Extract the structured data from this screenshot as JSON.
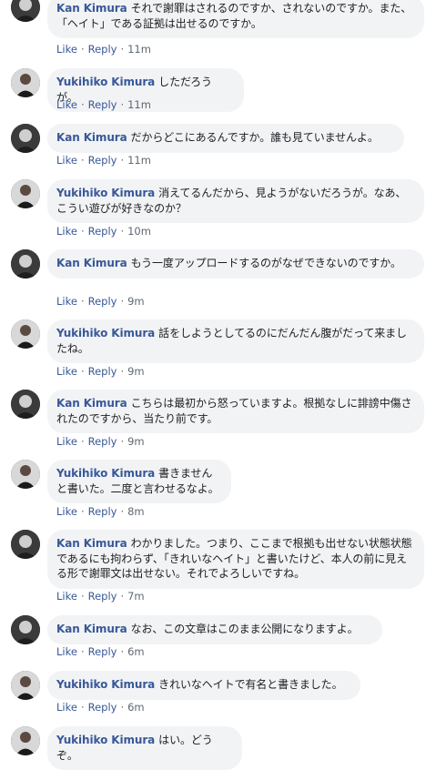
{
  "actions": {
    "like": "Like",
    "reply": "Reply",
    "separator": "·"
  },
  "comments": [
    {
      "author": "Kan Kimura",
      "avatar": "kan",
      "text": "それで謝罪はされるのですか、されないのですか。また、「ヘイト」である証拠は出せるのですか。",
      "time": "11m"
    },
    {
      "author": "Yukihiko Kimura",
      "avatar": "yukihiko",
      "text": "しただろうが。",
      "time": "11m"
    },
    {
      "author": "Kan Kimura",
      "avatar": "kan",
      "text": "だからどこにあるんですか。誰も見ていませんよ。",
      "time": "11m"
    },
    {
      "author": "Yukihiko Kimura",
      "avatar": "yukihiko",
      "text": "消えてるんだから、見ようがないだろうが。なあ、こうい遊びが好きなのか？",
      "time": "10m"
    },
    {
      "author": "Kan Kimura",
      "avatar": "kan",
      "text": "もう一度アップロードするのがなぜできないのですか。",
      "time": "9m"
    },
    {
      "author": "Yukihiko Kimura",
      "avatar": "yukihiko",
      "text": "話をしようとしてるのにだんだん腹がだって来ましたね。",
      "time": "9m"
    },
    {
      "author": "Kan Kimura",
      "avatar": "kan",
      "text": "こちらは最初から怒っていますよ。根拠なしに誹謗中傷されたのですから、当たり前です。",
      "time": "9m"
    },
    {
      "author": "Yukihiko Kimura",
      "avatar": "yukihiko",
      "text": "書きませんと書いた。二度と言わせるなよ。",
      "time": "8m"
    },
    {
      "author": "Kan Kimura",
      "avatar": "kan",
      "text": "わかりました。つまり、ここまで根拠も出せない状態状態であるにも拘わらず、「きれいなヘイト」と書いたけど、本人の前に見える形で謝罪文は出せない。それでよろしいですね。",
      "time": "7m"
    },
    {
      "author": "Kan Kimura",
      "avatar": "kan",
      "text": "なお、この文章はこのまま公開になりますよ。",
      "time": "6m"
    },
    {
      "author": "Yukihiko Kimura",
      "avatar": "yukihiko",
      "text": "きれいなヘイトで有名と書きました。",
      "time": "6m"
    },
    {
      "author": "Yukihiko Kimura",
      "avatar": "yukihiko",
      "text": "はい。どうぞ。",
      "time": ""
    }
  ]
}
